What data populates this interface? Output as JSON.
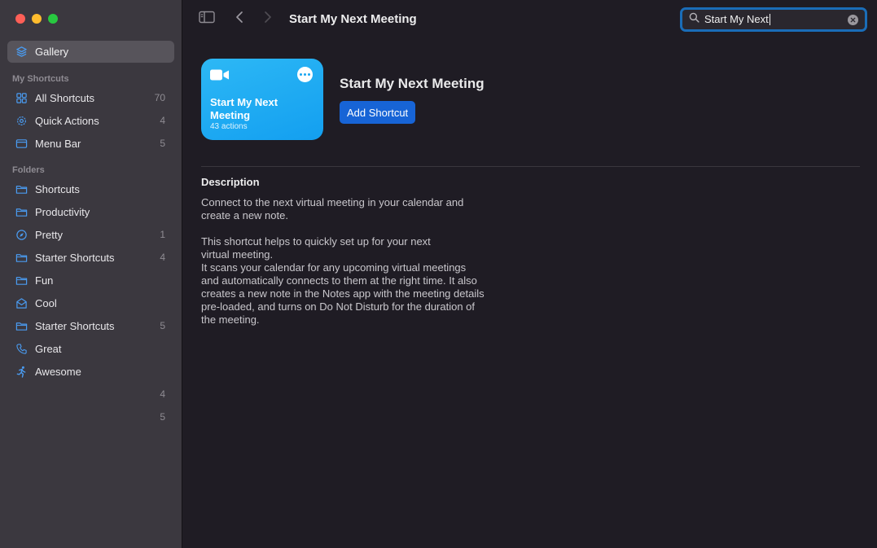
{
  "sidebar": {
    "gallery": {
      "label": "Gallery",
      "icon": "gallery-icon"
    },
    "my_shortcuts_heading": "My Shortcuts",
    "my_shortcuts": [
      {
        "label": "All Shortcuts",
        "count": "70",
        "icon": "grid-icon"
      },
      {
        "label": "Quick Actions",
        "count": "4",
        "icon": "gear-icon"
      },
      {
        "label": "Menu Bar",
        "count": "5",
        "icon": "menubar-icon"
      }
    ],
    "folders_heading": "Folders",
    "folders": [
      {
        "label": "Shortcuts",
        "count": "",
        "icon": "folder-icon"
      },
      {
        "label": "Productivity",
        "count": "",
        "icon": "folder-icon"
      },
      {
        "label": "Pretty",
        "count": "1",
        "icon": "compass-icon"
      },
      {
        "label": "Starter Shortcuts",
        "count": "4",
        "icon": "folder-icon"
      },
      {
        "label": "Fun",
        "count": "",
        "icon": "folder-icon"
      },
      {
        "label": "Cool",
        "count": "",
        "icon": "envelope-icon"
      },
      {
        "label": "Starter Shortcuts",
        "count": "5",
        "icon": "folder-icon"
      },
      {
        "label": "Great",
        "count": "",
        "icon": "phone-icon"
      },
      {
        "label": "Awesome",
        "count": "",
        "icon": "running-figure-icon"
      }
    ],
    "orphan_counts": [
      "4",
      "5"
    ]
  },
  "toolbar": {
    "title": "Start My Next Meeting",
    "search_value": "Start My Next"
  },
  "shortcut": {
    "card_name": "Start My Next Meeting",
    "actions": "43 actions",
    "title": "Start My Next Meeting",
    "add_button": "Add Shortcut",
    "color": "#1ba8f2"
  },
  "description": {
    "heading": "Description",
    "para1": "Connect to the next virtual meeting in your calendar and\ncreate a new note.",
    "para2": "This shortcut helps to quickly set up for your next\nvirtual meeting.\nIt scans your calendar for any upcoming virtual meetings\nand automatically connects to them at the right time. It also\ncreates a new note in the Notes app with the meeting details\npre-loaded, and turns on Do Not Disturb for the duration of\nthe meeting."
  }
}
